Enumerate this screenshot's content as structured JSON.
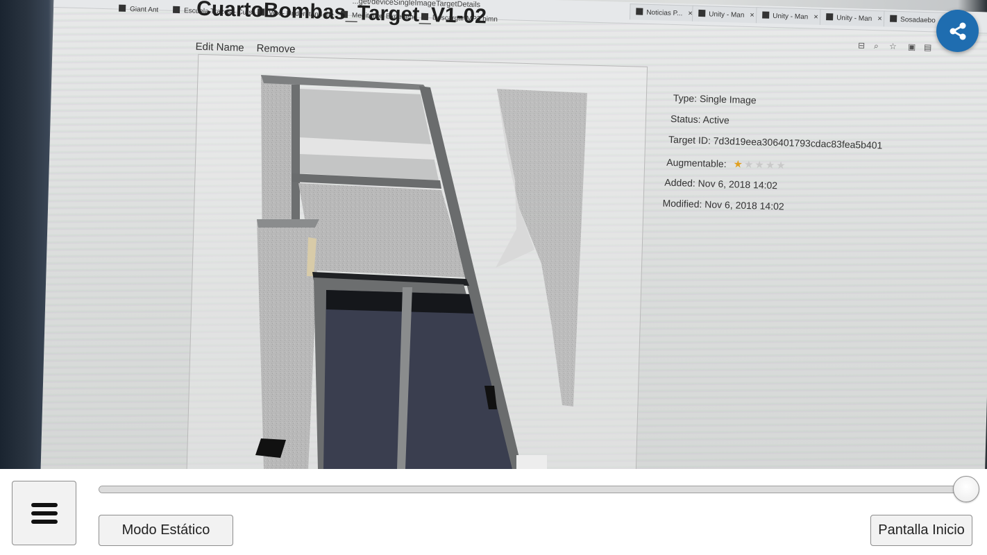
{
  "browser": {
    "url_fragment": "...get/deviceSingleImageTargetDetails",
    "bookmarks": [
      "Giant Ant",
      "Escuela Trazos - Curs",
      "Vox - Understand the",
      "Meditation Experienc",
      "Descargar MP3 himn"
    ],
    "tabs": [
      {
        "label": "Noticias P..."
      },
      {
        "label": "Unity - Man"
      },
      {
        "label": "Unity - Man"
      },
      {
        "label": "Unity - Man"
      },
      {
        "label": "Sosadaebo"
      }
    ],
    "tab_close_glyph": "×"
  },
  "web_page": {
    "title": "CuartoBombas_Target_V1-02",
    "edit_name_label": "Edit Name",
    "remove_label": "Remove",
    "details": {
      "type": "Type: Single Image",
      "status": "Status: Active",
      "target_id": "Target ID: 7d3d19eea306401793cdac83fea5b401",
      "augmentable_label": "Augmentable:",
      "augmentable_rating": 1,
      "augmentable_max": 5,
      "added": "Added: Nov 6, 2018 14:02",
      "modified": "Modified: Nov 6, 2018 14:02"
    }
  },
  "share": {
    "icon": "share-icon",
    "color": "#1f6db0"
  },
  "controls": {
    "menu_icon": "hamburger-menu-icon",
    "slider_value": 1.0,
    "modo_estatico_label": "Modo Estático",
    "pantalla_inicio_label": "Pantalla Inicio"
  }
}
